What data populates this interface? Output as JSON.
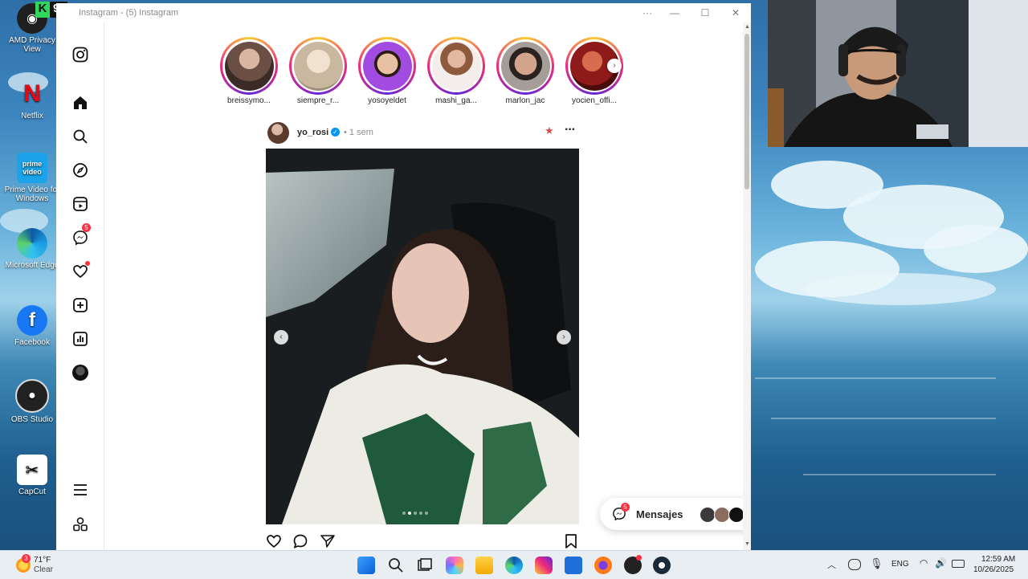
{
  "desktop": {
    "overlay_badge": "9",
    "icons": [
      {
        "label": "AMD Privacy View",
        "color": "#1f1f1f"
      },
      {
        "label": "Netflix",
        "color": "#e50914"
      },
      {
        "label": "Prime Video for Windows",
        "color": "#1aa3e8",
        "glyph": "prime video"
      },
      {
        "label": "Microsoft Edge",
        "color": "#1b8bd6"
      },
      {
        "label": "Facebook",
        "color": "#1877f2",
        "glyph": "f"
      },
      {
        "label": "OBS Studio",
        "color": "#222"
      },
      {
        "label": "CapCut",
        "color": "#ffffff"
      }
    ]
  },
  "window": {
    "title": "Instagram - (5) Instagram",
    "controls": {
      "more": "···",
      "minimize": "—",
      "maximize": "☐",
      "close": "✕"
    }
  },
  "sidebar": {
    "messages_badge": "5"
  },
  "stories": [
    {
      "name": "breissymo...",
      "color": "#6b4f45"
    },
    {
      "name": "siempre_r...",
      "color": "#c9b79f"
    },
    {
      "name": "yosoyeldet",
      "color": "#a24be0"
    },
    {
      "name": "mashi_ga...",
      "color": "#d9c5bd"
    },
    {
      "name": "marlon_jac",
      "color": "#6b5a52"
    },
    {
      "name": "yocien_offi...",
      "color": "#8e1a1a"
    }
  ],
  "post": {
    "username": "yo_rosi",
    "verified_glyph": "✓",
    "time": "• 1 sem",
    "options": "···"
  },
  "messages_pill": {
    "label": "Mensajes",
    "badge": "5",
    "more": "···"
  },
  "taskbar": {
    "weather": {
      "temp": "71°F",
      "condition": "Clear",
      "badge": "3"
    },
    "language": "ENG",
    "time": "12:59 AM",
    "date": "10/26/2025"
  }
}
